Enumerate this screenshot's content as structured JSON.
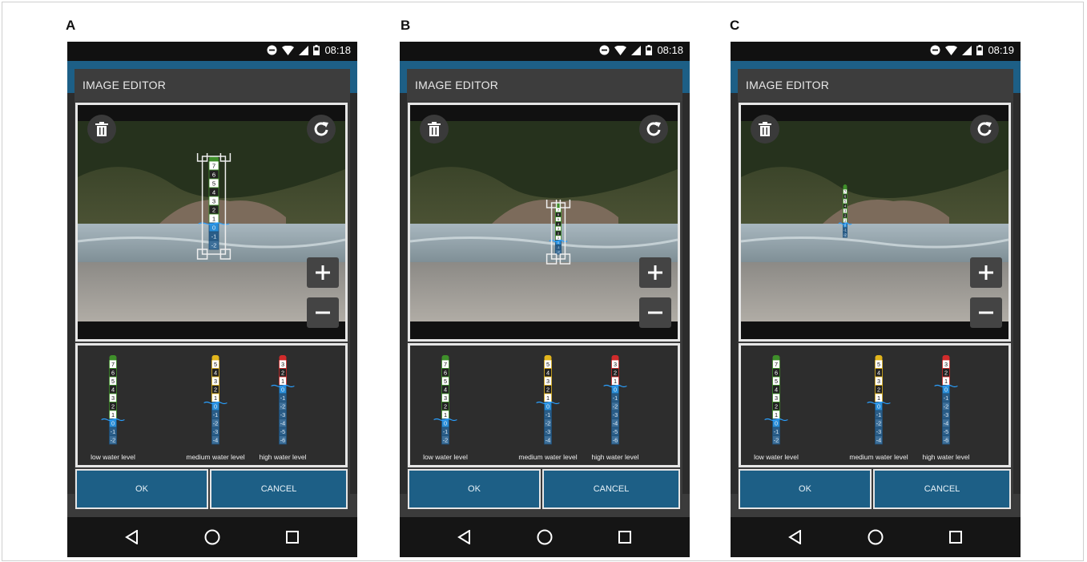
{
  "panels": [
    {
      "label": "A",
      "time": "08:18",
      "dialog_title": "IMAGE EDITOR",
      "ok": "OK",
      "cancel": "CANCEL"
    },
    {
      "label": "B",
      "time": "08:18",
      "dialog_title": "IMAGE EDITOR",
      "ok": "OK",
      "cancel": "CANCEL"
    },
    {
      "label": "C",
      "time": "08:19",
      "dialog_title": "IMAGE EDITOR",
      "ok": "OK",
      "cancel": "CANCEL"
    }
  ],
  "gauges": [
    {
      "label": "low water level",
      "color": "#3f8f2a",
      "top": "7",
      "values": [
        "7",
        "6",
        "5",
        "4",
        "3",
        "2",
        "1",
        "0",
        "-1",
        "-2"
      ]
    },
    {
      "label": "medium water level",
      "color": "#e2b51c",
      "top": "5",
      "values": [
        "5",
        "4",
        "3",
        "2",
        "1",
        "0",
        "-1",
        "-2",
        "-3",
        "-4"
      ]
    },
    {
      "label": "high water level",
      "color": "#d12b2b",
      "top": "3",
      "values": [
        "3",
        "2",
        "1",
        "0",
        "-1",
        "-2",
        "-3",
        "-4",
        "-5",
        "-6"
      ]
    }
  ],
  "icons": {
    "delete": "trash-icon",
    "rotate": "rotate-icon",
    "zoom_in": "plus-icon",
    "zoom_out": "minus-icon",
    "back": "back-triangle-icon",
    "home": "home-circle-icon",
    "recents": "recents-square-icon",
    "dnd": "do-not-disturb-icon",
    "wifi": "wifi-icon",
    "signal": "signal-icon",
    "battery": "battery-icon"
  },
  "colors": {
    "accent": "#1d5f86",
    "dialog": "#3a3a3a",
    "frame": "#e6e6e6"
  }
}
